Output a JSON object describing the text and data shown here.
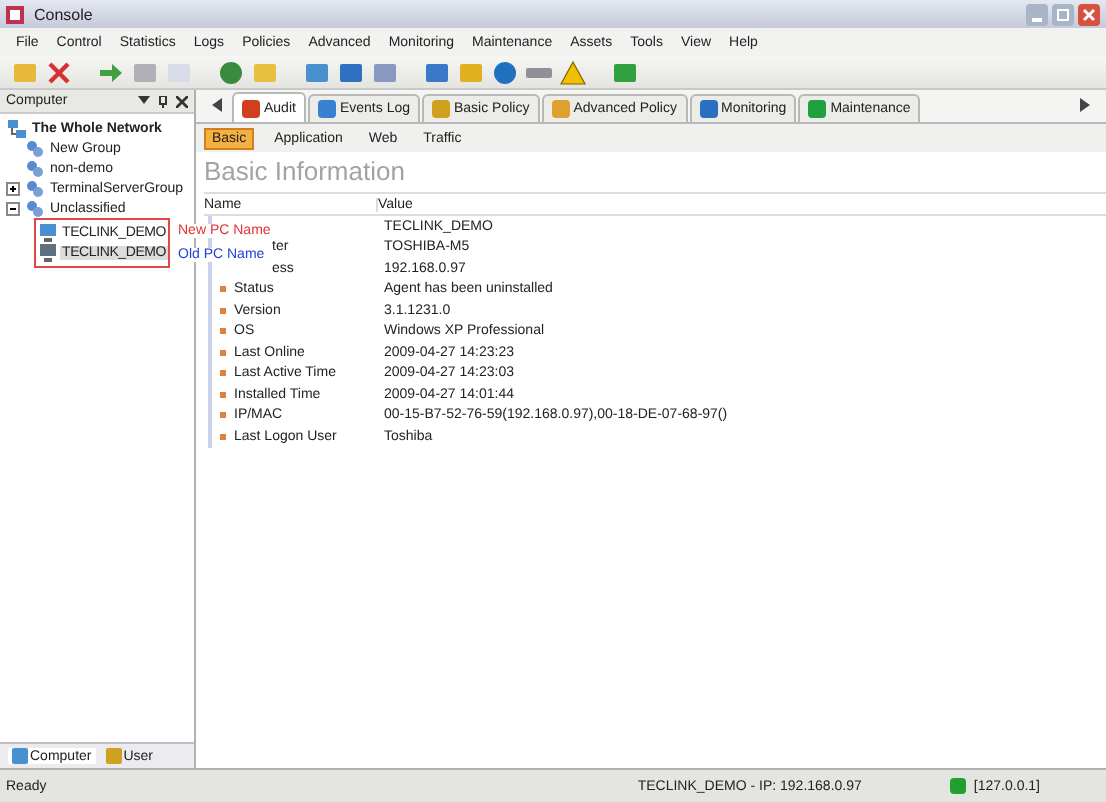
{
  "window": {
    "title": "Console"
  },
  "menu": [
    "File",
    "Control",
    "Statistics",
    "Logs",
    "Policies",
    "Advanced",
    "Monitoring",
    "Maintenance",
    "Assets",
    "Tools",
    "View",
    "Help"
  ],
  "sidebar": {
    "title": "Computer",
    "tree": [
      {
        "label": "The Whole Network",
        "selected": false,
        "children": [
          {
            "label": "New Group",
            "selected": false
          },
          {
            "label": "non-demo",
            "selected": false
          },
          {
            "label": "TerminalServerGroup",
            "expanded": false,
            "selected": false
          },
          {
            "label": "Unclassified",
            "expanded": true,
            "selected": false,
            "children": [
              {
                "label": "TECLINK_DEMO",
                "selected": false
              },
              {
                "label": "TECLINK_DEMO",
                "selected": true
              }
            ]
          }
        ]
      }
    ],
    "tabs": [
      {
        "label": "Computer",
        "selected": true
      },
      {
        "label": "User",
        "selected": false
      }
    ]
  },
  "callouts": [
    {
      "label": "New PC Name",
      "color": "#e03030"
    },
    {
      "label": "Old PC Name",
      "color": "#2040d0"
    }
  ],
  "tabs": [
    {
      "label": "Audit",
      "selected": true
    },
    {
      "label": "Events Log",
      "selected": false
    },
    {
      "label": "Basic Policy",
      "selected": false
    },
    {
      "label": "Advanced Policy",
      "selected": false
    },
    {
      "label": "Monitoring",
      "selected": false
    },
    {
      "label": "Maintenance",
      "selected": false
    }
  ],
  "subtabs": [
    {
      "label": "Basic",
      "selected": true
    },
    {
      "label": "Application",
      "selected": false
    },
    {
      "label": "Web",
      "selected": false
    },
    {
      "label": "Traffic",
      "selected": false
    }
  ],
  "heading": "Basic Information",
  "table": {
    "columns": [
      "Name",
      "Value"
    ],
    "rows": [
      {
        "kind": "cut",
        "value": "TECLINK_DEMO"
      },
      {
        "kind": "cut",
        "name": "ter",
        "value": "TOSHIBA-M5"
      },
      {
        "kind": "cut",
        "name": "ess",
        "value": "192.168.0.97"
      },
      {
        "kind": "full",
        "name": "Status",
        "value": "Agent has been uninstalled"
      },
      {
        "kind": "full",
        "name": "Version",
        "value": "3.1.1231.0"
      },
      {
        "kind": "full",
        "name": "OS",
        "value": "Windows XP Professional"
      },
      {
        "kind": "full",
        "name": "Last Online",
        "value": "2009-04-27 14:23:23"
      },
      {
        "kind": "full",
        "name": "Last Active Time",
        "value": "2009-04-27 14:23:03"
      },
      {
        "kind": "full",
        "name": "Installed Time",
        "value": "2009-04-27 14:01:44"
      },
      {
        "kind": "full",
        "name": "IP/MAC",
        "value": "00-15-B7-52-76-59(192.168.0.97),00-18-DE-07-68-97()"
      },
      {
        "kind": "full",
        "name": "Last Logon User",
        "value": "Toshiba"
      }
    ]
  },
  "status_bar": {
    "left": "Ready",
    "computer": "TECLINK_DEMO - IP: 192.168.0.97",
    "server": "[127.0.0.1]"
  }
}
